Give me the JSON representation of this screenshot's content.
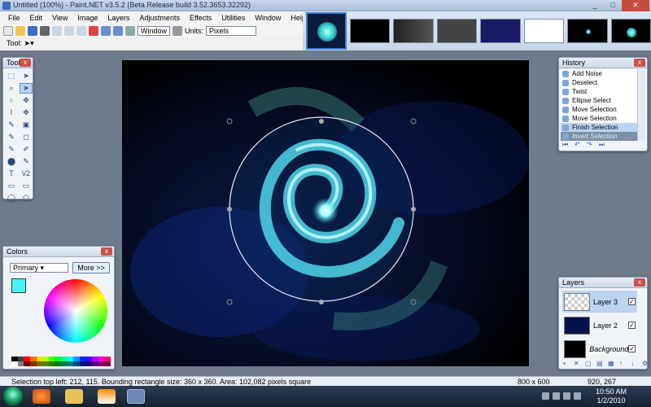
{
  "window": {
    "title": "Untitled (100%) - Paint.NET v3.5.2 (Beta Release build 3.52.3653.32292)",
    "min_label": "_",
    "max_label": "□",
    "close_label": "✕"
  },
  "menu": {
    "items": [
      "File",
      "Edit",
      "View",
      "Image",
      "Layers",
      "Adjustments",
      "Effects",
      "Utilities",
      "Window",
      "Help"
    ]
  },
  "toolbar": {
    "zoom_select": "Window",
    "units_label": "Units:",
    "units_select": "Pixels"
  },
  "tool_row": {
    "label": "Tool:"
  },
  "tools_panel": {
    "title": "Tools",
    "close": "x",
    "glyphs": [
      "⬚",
      "➤",
      "⌕",
      "➤",
      "○",
      "✥",
      "⌇",
      "✥",
      "✎",
      "▣",
      "✎",
      "◻",
      "✎",
      "✐",
      "⬤",
      "✎",
      "T",
      "\\/2",
      "▭",
      "▭",
      "◯",
      "⬠"
    ]
  },
  "colors_panel": {
    "title": "Colors",
    "close": "x",
    "mode_select": "Primary",
    "more_button": "More >>",
    "primary_color": "#49f4f4",
    "secondary_color": "#ffffff",
    "palette": [
      "#000000",
      "#404040",
      "#ff0000",
      "#ff6a00",
      "#ffd800",
      "#b6ff00",
      "#4cff00",
      "#00ff21",
      "#00ff90",
      "#00ffff",
      "#0094ff",
      "#0026ff",
      "#4800ff",
      "#b200ff",
      "#ff00dc",
      "#ff006e",
      "#ffffff",
      "#808080",
      "#7f0000",
      "#7f3300",
      "#7f6a00",
      "#5b7f00",
      "#267f00",
      "#007f0e",
      "#007f46",
      "#007f7f",
      "#004a7f",
      "#00137f",
      "#21007f",
      "#57007f",
      "#7f006e",
      "#7f0037"
    ]
  },
  "history_panel": {
    "title": "History",
    "close": "x",
    "items": [
      {
        "label": "Add Noise",
        "state": "normal"
      },
      {
        "label": "Deselect",
        "state": "normal"
      },
      {
        "label": "Twist",
        "state": "normal"
      },
      {
        "label": "Ellipse Select",
        "state": "normal"
      },
      {
        "label": "Move Selection",
        "state": "normal"
      },
      {
        "label": "Move Selection",
        "state": "normal"
      },
      {
        "label": "Finish Selection",
        "state": "selected"
      },
      {
        "label": "Invert Selection",
        "state": "undone"
      }
    ],
    "controls": [
      "⏮",
      "↶",
      "↷",
      "⏭"
    ]
  },
  "layers_panel": {
    "title": "Layers",
    "close": "x",
    "layers": [
      {
        "name": "Layer 3",
        "visible_mark": "✓",
        "thumb": "checker"
      },
      {
        "name": "Layer 2",
        "visible_mark": "✓",
        "thumb": "#08124a"
      },
      {
        "name": "Background",
        "visible_mark": "✓",
        "thumb": "#000000"
      }
    ],
    "controls": [
      "+",
      "✕",
      "▢",
      "▤",
      "▦",
      "↑",
      "↓",
      "⚙"
    ]
  },
  "status": {
    "text": "Selection top left: 212, 115. Bounding rectangle size: 360 x 360. Area: 102,082 pixels square",
    "image_size": "800 x 600",
    "cursor": "920, 267"
  },
  "taskbar": {
    "time": "10:50 AM",
    "date": "1/2/2010"
  },
  "colors": {
    "accent": "#3f7fd6",
    "spiral": "#4fd5e8"
  }
}
